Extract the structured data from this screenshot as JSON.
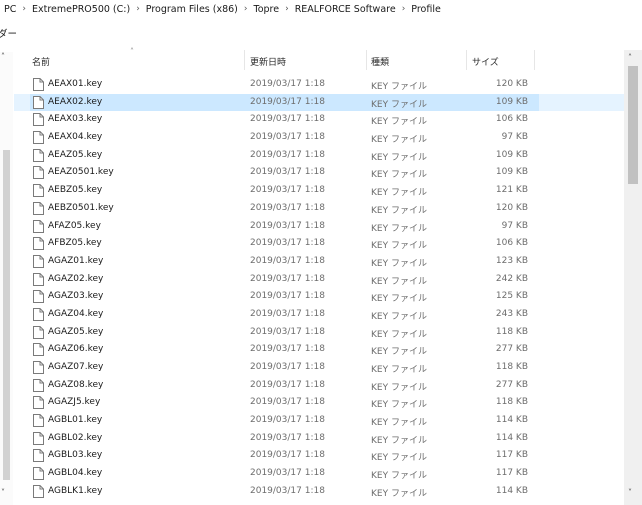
{
  "breadcrumb": [
    "PC",
    "ExtremePRO500 (C:)",
    "Program Files (x86)",
    "Topre",
    "REALFORCE Software",
    "Profile"
  ],
  "breadcrumb_sep": "›",
  "toolbar": {
    "label": "ダー"
  },
  "columns": {
    "name": "名前",
    "date": "更新日時",
    "type": "種類",
    "size": "サイズ"
  },
  "files": [
    {
      "name": "AEAX01.key",
      "date": "2019/03/17 1:18",
      "type": "KEY ファイル",
      "size": "120 KB"
    },
    {
      "name": "AEAX02.key",
      "date": "2019/03/17 1:18",
      "type": "KEY ファイル",
      "size": "109 KB"
    },
    {
      "name": "AEAX03.key",
      "date": "2019/03/17 1:18",
      "type": "KEY ファイル",
      "size": "106 KB"
    },
    {
      "name": "AEAX04.key",
      "date": "2019/03/17 1:18",
      "type": "KEY ファイル",
      "size": "97 KB"
    },
    {
      "name": "AEAZ05.key",
      "date": "2019/03/17 1:18",
      "type": "KEY ファイル",
      "size": "109 KB"
    },
    {
      "name": "AEAZ0501.key",
      "date": "2019/03/17 1:18",
      "type": "KEY ファイル",
      "size": "109 KB"
    },
    {
      "name": "AEBZ05.key",
      "date": "2019/03/17 1:18",
      "type": "KEY ファイル",
      "size": "121 KB"
    },
    {
      "name": "AEBZ0501.key",
      "date": "2019/03/17 1:18",
      "type": "KEY ファイル",
      "size": "120 KB"
    },
    {
      "name": "AFAZ05.key",
      "date": "2019/03/17 1:18",
      "type": "KEY ファイル",
      "size": "97 KB"
    },
    {
      "name": "AFBZ05.key",
      "date": "2019/03/17 1:18",
      "type": "KEY ファイル",
      "size": "106 KB"
    },
    {
      "name": "AGAZ01.key",
      "date": "2019/03/17 1:18",
      "type": "KEY ファイル",
      "size": "123 KB"
    },
    {
      "name": "AGAZ02.key",
      "date": "2019/03/17 1:18",
      "type": "KEY ファイル",
      "size": "242 KB"
    },
    {
      "name": "AGAZ03.key",
      "date": "2019/03/17 1:18",
      "type": "KEY ファイル",
      "size": "125 KB"
    },
    {
      "name": "AGAZ04.key",
      "date": "2019/03/17 1:18",
      "type": "KEY ファイル",
      "size": "243 KB"
    },
    {
      "name": "AGAZ05.key",
      "date": "2019/03/17 1:18",
      "type": "KEY ファイル",
      "size": "118 KB"
    },
    {
      "name": "AGAZ06.key",
      "date": "2019/03/17 1:18",
      "type": "KEY ファイル",
      "size": "277 KB"
    },
    {
      "name": "AGAZ07.key",
      "date": "2019/03/17 1:18",
      "type": "KEY ファイル",
      "size": "118 KB"
    },
    {
      "name": "AGAZ08.key",
      "date": "2019/03/17 1:18",
      "type": "KEY ファイル",
      "size": "277 KB"
    },
    {
      "name": "AGAZJ5.key",
      "date": "2019/03/17 1:18",
      "type": "KEY ファイル",
      "size": "118 KB"
    },
    {
      "name": "AGBL01.key",
      "date": "2019/03/17 1:18",
      "type": "KEY ファイル",
      "size": "114 KB"
    },
    {
      "name": "AGBL02.key",
      "date": "2019/03/17 1:18",
      "type": "KEY ファイル",
      "size": "114 KB"
    },
    {
      "name": "AGBL03.key",
      "date": "2019/03/17 1:18",
      "type": "KEY ファイル",
      "size": "117 KB"
    },
    {
      "name": "AGBL04.key",
      "date": "2019/03/17 1:18",
      "type": "KEY ファイル",
      "size": "117 KB"
    },
    {
      "name": "AGBLK1.key",
      "date": "2019/03/17 1:18",
      "type": "KEY ファイル",
      "size": "114 KB"
    }
  ],
  "selected_index": 1,
  "icons": {
    "file": "file-icon",
    "sort": "sort-ascending-icon",
    "up": "scroll-up-arrow-icon",
    "down": "scroll-down-arrow-icon"
  },
  "colors": {
    "selection_bg": "#cce8ff",
    "hover_bg": "#e5f3ff",
    "secondary_text": "#6d6d6d"
  }
}
